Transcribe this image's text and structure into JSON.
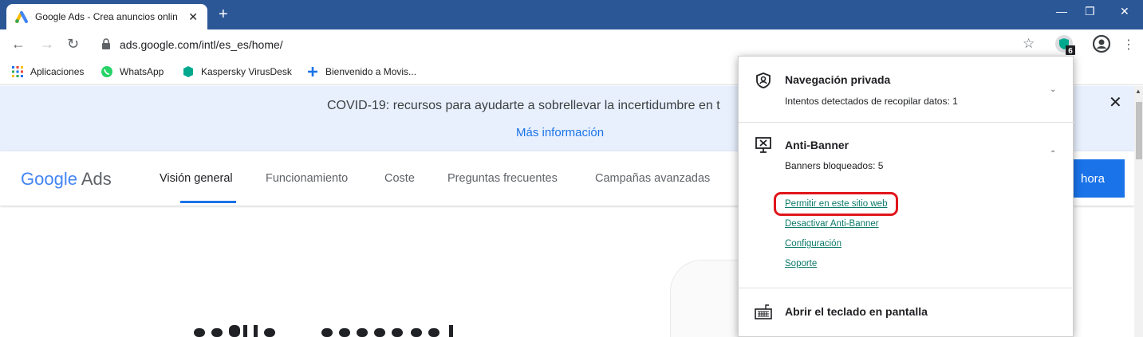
{
  "browser": {
    "tab_title": "Google Ads - Crea anuncios onlin",
    "url": "ads.google.com/intl/es_es/home/",
    "extension_badge": "6"
  },
  "bookmarks": [
    {
      "label": "Aplicaciones",
      "icon": "apps-grid-icon"
    },
    {
      "label": "WhatsApp",
      "icon": "whatsapp-icon"
    },
    {
      "label": "Kaspersky VirusDesk",
      "icon": "kaspersky-icon"
    },
    {
      "label": "Bienvenido a Movis...",
      "icon": "plus-icon"
    }
  ],
  "banner": {
    "message": "COVID-19: recursos para ayudarte a sobrellevar la incertidumbre en t",
    "link": "Más información"
  },
  "nav": {
    "logo_google": "Google",
    "logo_ads": "Ads",
    "items": [
      "Visión general",
      "Funcionamiento",
      "Coste",
      "Preguntas frecuentes",
      "Campañas avanzadas"
    ],
    "cta": "hora"
  },
  "popup": {
    "private": {
      "title": "Navegación privada",
      "subtitle": "Intentos detectados de recopilar datos: 1"
    },
    "antibanner": {
      "title": "Anti-Banner",
      "subtitle": "Banners bloqueados: 5",
      "links": [
        "Permitir en este sitio web",
        "Desactivar Anti-Banner",
        "Configuración",
        "Soporte"
      ]
    },
    "keyboard": {
      "title": "Abrir el teclado en pantalla"
    }
  },
  "colors": {
    "titlebar": "#2b5797",
    "accent": "#1a73e8",
    "link": "#0d7a6a",
    "highlight": "#e0161b"
  }
}
